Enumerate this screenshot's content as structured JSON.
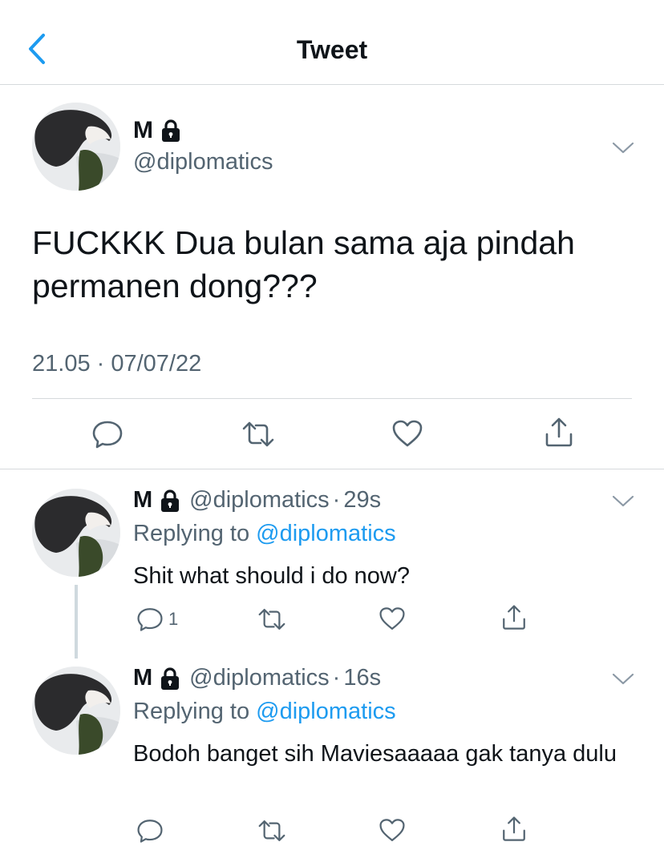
{
  "header": {
    "title": "Tweet",
    "back_icon": "chevron-left-icon",
    "accent": "#1d9bf0"
  },
  "main_tweet": {
    "name": "M",
    "handle": "@diplomatics",
    "text": "FUCKKK Dua bulan sama aja pindah permanen dong???",
    "timestamp": "21.05 · 07/07/22",
    "actions": [
      "reply-icon",
      "retweet-icon",
      "like-icon",
      "share-icon"
    ]
  },
  "replies": [
    {
      "name": "M",
      "handle": "@diplomatics",
      "dot": "·",
      "time": "29s",
      "replying_label": "Replying to",
      "replying_to": "@diplomatics",
      "text": "Shit what should i do now?",
      "reply_count": "1"
    },
    {
      "name": "M",
      "handle": "@diplomatics",
      "dot": "·",
      "time": "16s",
      "replying_label": "Replying to",
      "replying_to": "@diplomatics",
      "text": "Bodoh banget sih Maviesaaaaa gak tanya dulu",
      "reply_count": ""
    }
  ],
  "colors": {
    "text": "#0f1419",
    "secondary": "#536471",
    "link": "#1d9bf0",
    "divider": "#d6d9dc"
  }
}
